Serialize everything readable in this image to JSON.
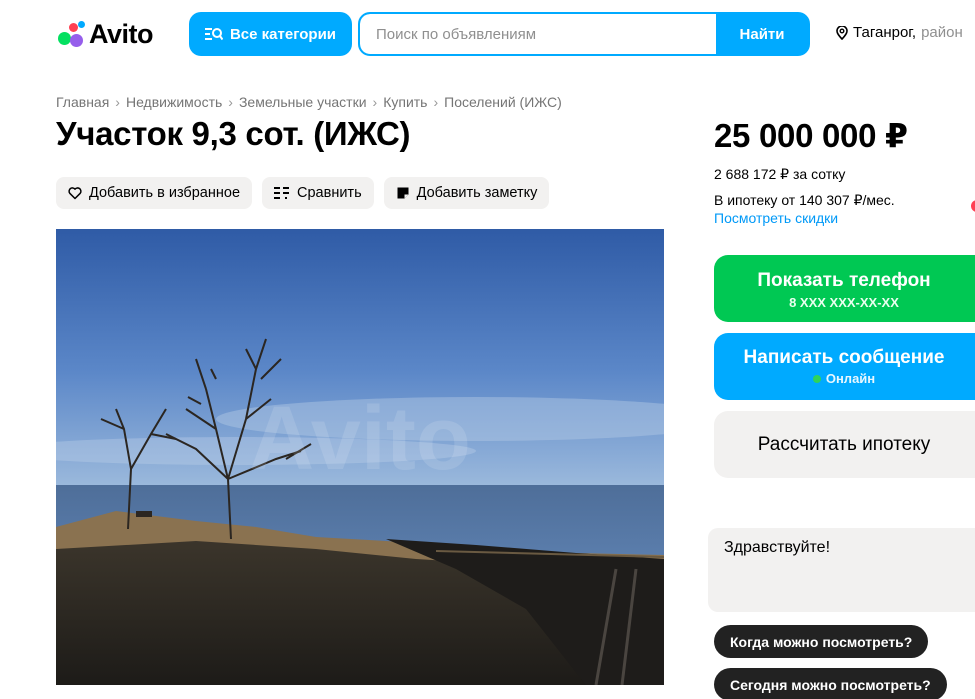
{
  "header": {
    "logo_text": "Avito",
    "categories_label": "Все категории",
    "search_placeholder": "Поиск по объявлениям",
    "search_button": "Найти",
    "location_city": "Таганрог,",
    "location_region": "район"
  },
  "breadcrumbs": [
    "Главная",
    "Недвижимость",
    "Земельные участки",
    "Купить",
    "Поселений (ИЖС)"
  ],
  "breadcrumb_separator": "›",
  "listing": {
    "title": "Участок 9,3 сот. (ИЖС)",
    "actions": {
      "favorite": "Добавить в избранное",
      "compare": "Сравнить",
      "note": "Добавить заметку"
    },
    "photo_watermark": "Avito"
  },
  "sidebar": {
    "price": "25 000 000 ₽",
    "price_per_unit": "2 688 172 ₽ за сотку",
    "mortgage": "В ипотеку от 140 307 ₽/мес.",
    "discounts_link": "Посмотреть скидки",
    "phone_button": "Показать телефон",
    "phone_masked": "8 XXX XXX-XX-XX",
    "message_button": "Написать сообщение",
    "online_status": "Онлайн",
    "mortgage_button": "Рассчитать ипотеку",
    "chat_text": "Здравствуйте!",
    "quick_replies": [
      "Когда можно посмотреть?",
      "Сегодня можно посмотреть?"
    ]
  },
  "colors": {
    "accent_blue": "#00aaff",
    "accent_green": "#00c853",
    "link": "#0099f7",
    "chip_dark": "#222222"
  },
  "icons": [
    "avito-logo-dots-icon",
    "categories-search-icon",
    "location-pin-icon",
    "heart-icon",
    "compare-icon",
    "note-icon",
    "online-dot-icon"
  ]
}
